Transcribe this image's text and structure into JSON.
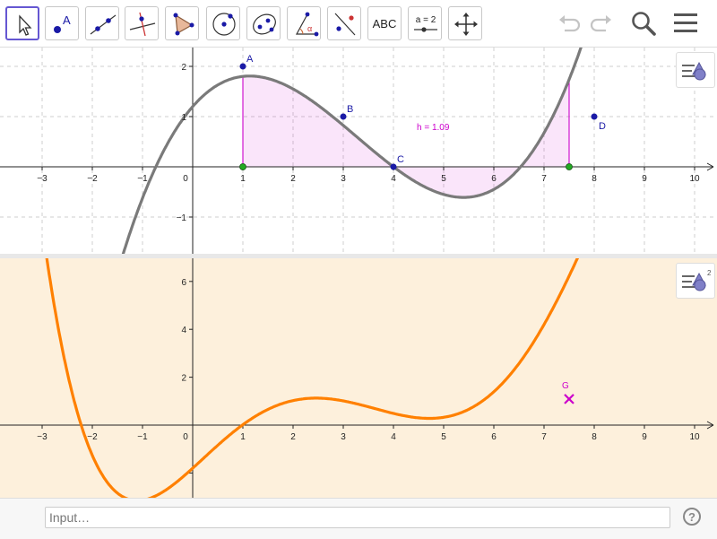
{
  "toolbar": {
    "tools": [
      {
        "name": "move-tool",
        "icon": "cursor-arrow-icon",
        "selected": true
      },
      {
        "name": "point-tool",
        "icon": "point-a-icon",
        "label": "A"
      },
      {
        "name": "line-tool",
        "icon": "line-through-points-icon"
      },
      {
        "name": "perpendicular-tool",
        "icon": "perpendicular-line-icon"
      },
      {
        "name": "polygon-tool",
        "icon": "polygon-icon"
      },
      {
        "name": "circle-tool",
        "icon": "circle-center-point-icon"
      },
      {
        "name": "ellipse-tool",
        "icon": "ellipse-icon"
      },
      {
        "name": "angle-tool",
        "icon": "angle-icon",
        "label": "α"
      },
      {
        "name": "reflect-tool",
        "icon": "reflect-about-line-icon"
      },
      {
        "name": "text-tool",
        "icon": "text-icon",
        "label": "ABC"
      },
      {
        "name": "slider-tool",
        "icon": "slider-icon",
        "label": "a = 2"
      },
      {
        "name": "move-view-tool",
        "icon": "move-graphics-view-icon"
      }
    ],
    "actions": [
      {
        "name": "undo-button",
        "icon": "undo-icon"
      },
      {
        "name": "redo-button",
        "icon": "redo-icon"
      },
      {
        "name": "search-button",
        "icon": "search-icon"
      },
      {
        "name": "menu-button",
        "icon": "hamburger-menu-icon"
      }
    ]
  },
  "graphics1": {
    "x_ticks": [
      "−3",
      "−2",
      "−1",
      "0",
      "1",
      "2",
      "3",
      "4",
      "5",
      "6",
      "7",
      "8",
      "9",
      "10"
    ],
    "y_ticks": [
      "2",
      "1",
      "−1"
    ],
    "points": [
      {
        "label": "A",
        "x": 1,
        "y": 2
      },
      {
        "label": "B",
        "x": 3,
        "y": 1
      },
      {
        "label": "C",
        "x": 4,
        "y": 0
      },
      {
        "label": "D",
        "x": 8,
        "y": 1
      }
    ],
    "green_points": [
      {
        "x": 1,
        "y": 0
      },
      {
        "x": 7.5,
        "y": 0
      }
    ],
    "h_label": "h = 1.09",
    "curve_color": "#7a7a7a",
    "shade_color": "#cc00cc"
  },
  "graphics2": {
    "x_ticks": [
      "−3",
      "−2",
      "−1",
      "0",
      "1",
      "2",
      "3",
      "4",
      "5",
      "6",
      "7",
      "8",
      "9",
      "10"
    ],
    "y_ticks": [
      "6",
      "4",
      "2"
    ],
    "point": {
      "label": "G",
      "x": 7.5,
      "y": 1.09
    },
    "curve_color": "#ff8000",
    "point_color": "#cc00cc",
    "background": "#fdf0dc"
  },
  "input": {
    "placeholder": "Input…",
    "help": "?"
  },
  "colors": {
    "accent": "#6557d2",
    "point_blue": "#1a1aa6",
    "point_green": "#22aa22"
  }
}
